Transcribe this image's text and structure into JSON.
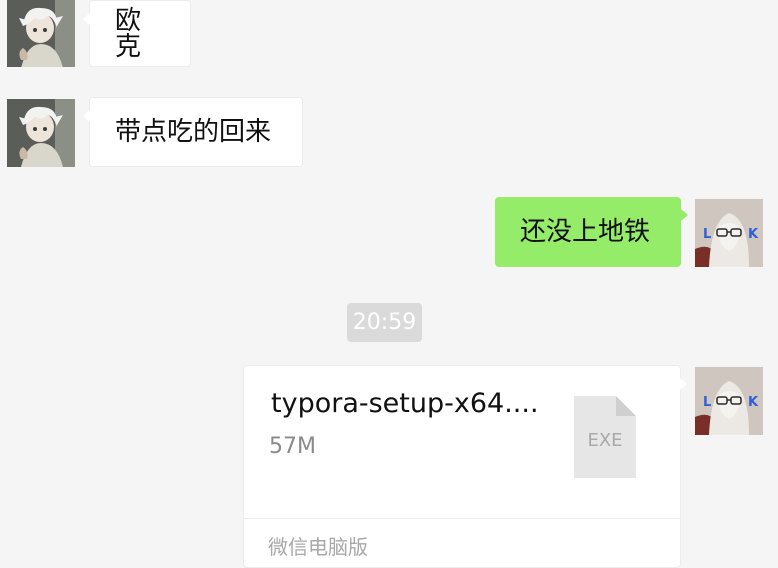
{
  "messages": [
    {
      "from": "contact",
      "text": "欧克"
    },
    {
      "from": "contact",
      "text": "带点吃的回来"
    },
    {
      "from": "self",
      "text": "还没上地铁"
    }
  ],
  "timestamp": "20:59",
  "file_message": {
    "file_name": "typora-setup-x64....",
    "file_size": "57M",
    "file_type": "EXE",
    "source": "微信电脑版"
  },
  "colors": {
    "background": "#f5f5f5",
    "incoming_bubble": "#ffffff",
    "outgoing_bubble": "#95ec69",
    "timestamp_chip": "#dadada"
  },
  "icons": {
    "contact_avatar": "contact-avatar-anime-icon",
    "self_avatar": "self-avatar-photo-icon",
    "file_icon": "exe-file-icon"
  }
}
